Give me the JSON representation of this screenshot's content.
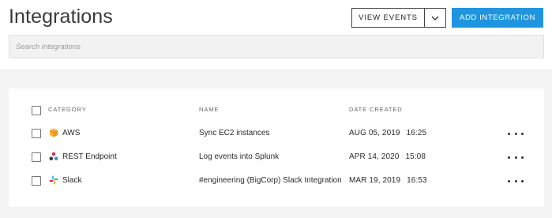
{
  "header": {
    "title": "Integrations",
    "view_events_label": "VIEW EVENTS",
    "add_integration_label": "ADD INTEGRATION",
    "accent_color": "#1f95e0"
  },
  "search": {
    "placeholder": "Search integrations",
    "value": ""
  },
  "table": {
    "columns": [
      "CATEGORY",
      "NAME",
      "DATE CREATED"
    ],
    "rows": [
      {
        "category": "AWS",
        "icon": "aws-cube-icon",
        "name": "Sync EC2 instances",
        "date": "AUG 05, 2019",
        "time": "16:25"
      },
      {
        "category": "REST Endpoint",
        "icon": "rest-endpoint-icon",
        "name": "Log events into Splunk",
        "date": "APR 14, 2020",
        "time": "15:08"
      },
      {
        "category": "Slack",
        "icon": "slack-icon",
        "name": "#engineering (BigCorp) Slack Integration",
        "date": "MAR 19, 2019",
        "time": "16:53"
      }
    ]
  }
}
